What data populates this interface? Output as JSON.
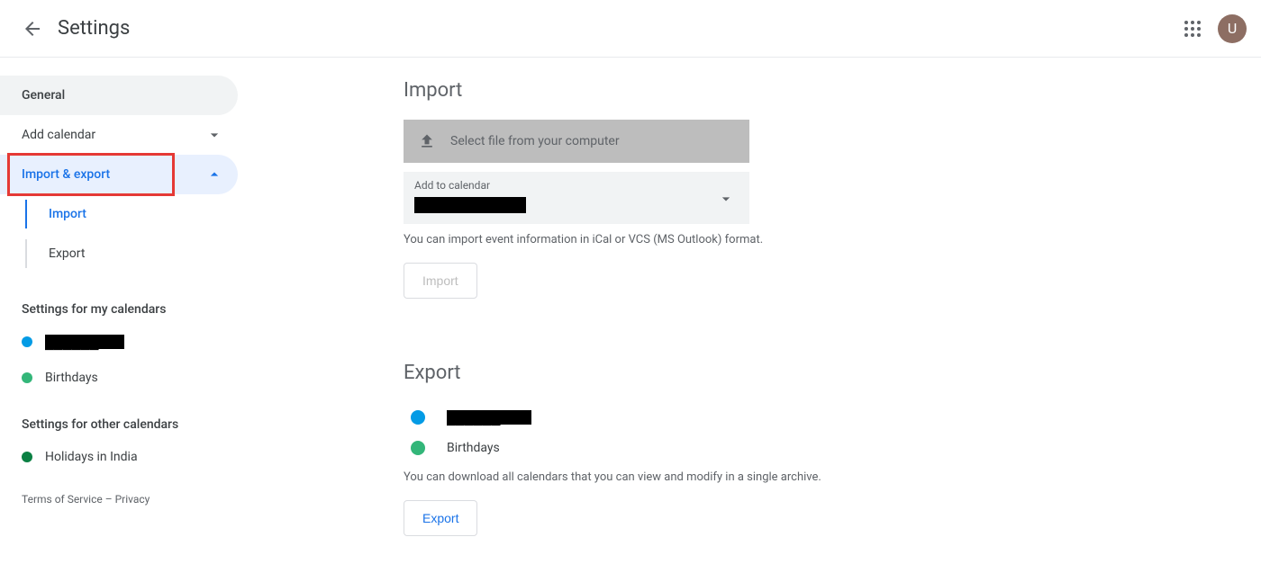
{
  "header": {
    "title": "Settings",
    "avatar_initial": "U"
  },
  "sidebar": {
    "general": "General",
    "add_calendar": "Add calendar",
    "import_export": "Import & export",
    "sub": {
      "import": "Import",
      "export": "Export"
    },
    "my_calendars_heading": "Settings for my calendars",
    "my_calendars": [
      {
        "color": "#039be5",
        "name": "██████"
      },
      {
        "color": "#33b679",
        "name": "Birthdays"
      }
    ],
    "other_calendars_heading": "Settings for other calendars",
    "other_calendars": [
      {
        "color": "#0b8043",
        "name": "Holidays in India"
      }
    ],
    "footer": {
      "tos": "Terms of Service",
      "sep": " – ",
      "privacy": "Privacy"
    }
  },
  "main": {
    "import": {
      "title": "Import",
      "select_file": "Select file from your computer",
      "dropdown_label": "Add to calendar",
      "dropdown_value": "██████",
      "help": "You can import event information in iCal or VCS (MS Outlook) format.",
      "button": "Import"
    },
    "export": {
      "title": "Export",
      "rows": [
        {
          "color": "#039be5",
          "name": "██████"
        },
        {
          "color": "#33b679",
          "name": "Birthdays"
        }
      ],
      "help": "You can download all calendars that you can view and modify in a single archive.",
      "button": "Export"
    }
  }
}
